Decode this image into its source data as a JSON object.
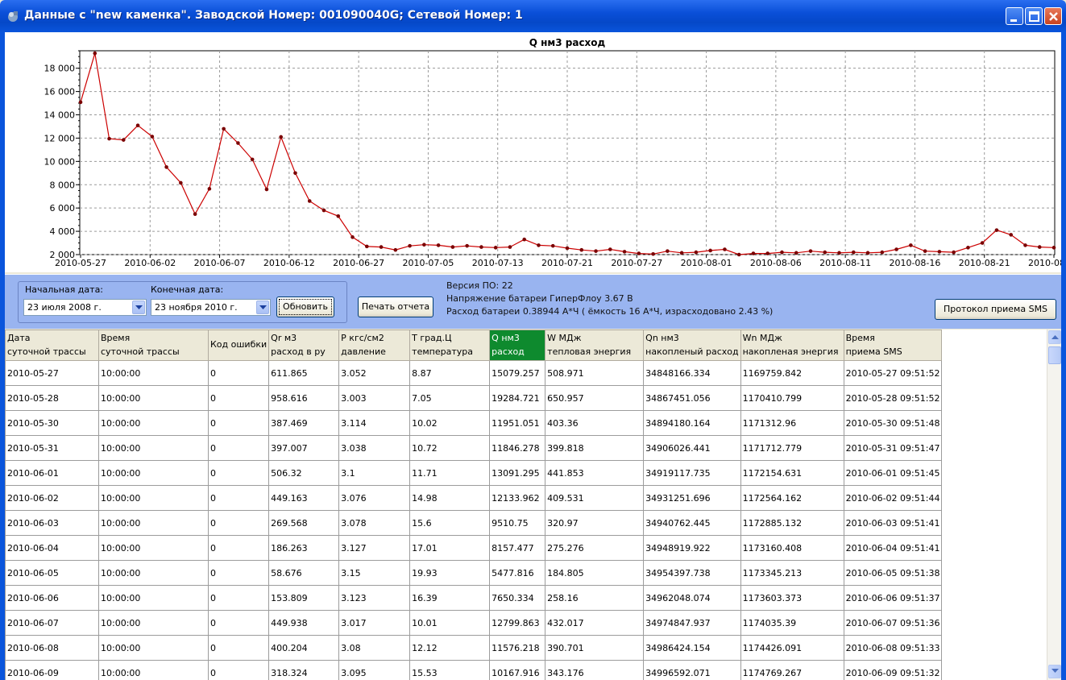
{
  "window": {
    "title": "Данные с \"new каменка\". Заводской Номер: 001090040G; Сетевой Номер: 1",
    "minimize_icon": "minimize-icon",
    "maximize_icon": "maximize-icon",
    "close_icon": "close-icon"
  },
  "chart_data": {
    "type": "line",
    "title": "Q нм3 расход",
    "xlabel": "",
    "ylabel": "",
    "ylim": [
      2000,
      19500
    ],
    "y_ticks": [
      "2 000",
      "4 000",
      "6 000",
      "8 000",
      "10 000",
      "12 000",
      "14 000",
      "16 000",
      "18 000"
    ],
    "x_tick_labels": [
      "2010-05-27",
      "2010-06-02",
      "2010-06-07",
      "2010-06-12",
      "2010-06-27",
      "2010-07-05",
      "2010-07-13",
      "2010-07-21",
      "2010-07-27",
      "2010-08-01",
      "2010-08-06",
      "2010-08-11",
      "2010-08-16",
      "2010-08-21",
      "2010-08-26"
    ],
    "grid": true,
    "line_color": "#cc0000",
    "series": [
      {
        "values": [
          15079,
          19285,
          11951,
          11846,
          13091,
          12134,
          9511,
          8157,
          5478,
          7650,
          12800,
          11576,
          10168,
          7600,
          12100,
          9000,
          6600,
          5800,
          5300,
          3500,
          2700,
          2650,
          2400,
          2750,
          2850,
          2800,
          2650,
          2750,
          2650,
          2600,
          2650,
          3300,
          2800,
          2750,
          2550,
          2400,
          2300,
          2450,
          2250,
          2100,
          2050,
          2300,
          2150,
          2200,
          2350,
          2450,
          2000,
          2100,
          2100,
          2200,
          2150,
          2300,
          2200,
          2150,
          2200,
          2150,
          2200,
          2450,
          2800,
          2300,
          2250,
          2200,
          2600,
          3000,
          4100,
          3700,
          2800,
          2650,
          2600
        ]
      }
    ]
  },
  "controls": {
    "start_label": "Начальная дата:",
    "end_label": "Конечная дата:",
    "start_value": "23   июля   2008 г.",
    "end_value": "23  ноября  2010 г.",
    "refresh_label": "Обновить",
    "print_label": "Печать отчета",
    "sms_label": "Протокол приема SMS",
    "version": "Версия ПО: 22",
    "voltage": "Напряжение батареи ГиперФлоу 3.67 В",
    "battery": "Расход батареи  0.38944  А*Ч  ( ёмкость 16 А*Ч, израсходовано 2.43 %)"
  },
  "table": {
    "headers": [
      [
        "Дата",
        "суточной трассы"
      ],
      [
        "Время",
        "суточной трассы"
      ],
      [
        "Код ошибки",
        ""
      ],
      [
        "Qr м3",
        "расход в ру"
      ],
      [
        "P кгс/см2",
        "давление"
      ],
      [
        "T град.Ц",
        "температура"
      ],
      [
        "Q нм3",
        "расход"
      ],
      [
        "W МДж",
        "тепловая энергия"
      ],
      [
        "Qn нм3",
        "накопленый расход"
      ],
      [
        "Wn МДж",
        "накопленая энергия"
      ],
      [
        "Время",
        "приема SMS"
      ]
    ],
    "rows": [
      [
        "2010-05-27",
        "10:00:00",
        "0",
        "611.865",
        "3.052",
        "8.87",
        "15079.257",
        "508.971",
        "34848166.334",
        "1169759.842",
        "2010-05-27 09:51:52"
      ],
      [
        "2010-05-28",
        "10:00:00",
        "0",
        "958.616",
        "3.003",
        "7.05",
        "19284.721",
        "650.957",
        "34867451.056",
        "1170410.799",
        "2010-05-28 09:51:52"
      ],
      [
        "2010-05-30",
        "10:00:00",
        "0",
        "387.469",
        "3.114",
        "10.02",
        "11951.051",
        "403.36",
        "34894180.164",
        "1171312.96",
        "2010-05-30 09:51:48"
      ],
      [
        "2010-05-31",
        "10:00:00",
        "0",
        "397.007",
        "3.038",
        "10.72",
        "11846.278",
        "399.818",
        "34906026.441",
        "1171712.779",
        "2010-05-31 09:51:47"
      ],
      [
        "2010-06-01",
        "10:00:00",
        "0",
        "506.32",
        "3.1",
        "11.71",
        "13091.295",
        "441.853",
        "34919117.735",
        "1172154.631",
        "2010-06-01 09:51:45"
      ],
      [
        "2010-06-02",
        "10:00:00",
        "0",
        "449.163",
        "3.076",
        "14.98",
        "12133.962",
        "409.531",
        "34931251.696",
        "1172564.162",
        "2010-06-02 09:51:44"
      ],
      [
        "2010-06-03",
        "10:00:00",
        "0",
        "269.568",
        "3.078",
        "15.6",
        "9510.75",
        "320.97",
        "34940762.445",
        "1172885.132",
        "2010-06-03 09:51:41"
      ],
      [
        "2010-06-04",
        "10:00:00",
        "0",
        "186.263",
        "3.127",
        "17.01",
        "8157.477",
        "275.276",
        "34948919.922",
        "1173160.408",
        "2010-06-04 09:51:41"
      ],
      [
        "2010-06-05",
        "10:00:00",
        "0",
        "58.676",
        "3.15",
        "19.93",
        "5477.816",
        "184.805",
        "34954397.738",
        "1173345.213",
        "2010-06-05 09:51:38"
      ],
      [
        "2010-06-06",
        "10:00:00",
        "0",
        "153.809",
        "3.123",
        "16.39",
        "7650.334",
        "258.16",
        "34962048.074",
        "1173603.373",
        "2010-06-06 09:51:37"
      ],
      [
        "2010-06-07",
        "10:00:00",
        "0",
        "449.938",
        "3.017",
        "10.01",
        "12799.863",
        "432.017",
        "34974847.937",
        "1174035.39",
        "2010-06-07 09:51:36"
      ],
      [
        "2010-06-08",
        "10:00:00",
        "0",
        "400.204",
        "3.08",
        "12.12",
        "11576.218",
        "390.701",
        "34986424.154",
        "1174426.091",
        "2010-06-08 09:51:33"
      ],
      [
        "2010-06-09",
        "10:00:00",
        "0",
        "318.324",
        "3.095",
        "15.53",
        "10167.916",
        "343.176",
        "34996592.071",
        "1174769.267",
        "2010-06-09 09:51:32"
      ]
    ],
    "selected_column": 6
  }
}
